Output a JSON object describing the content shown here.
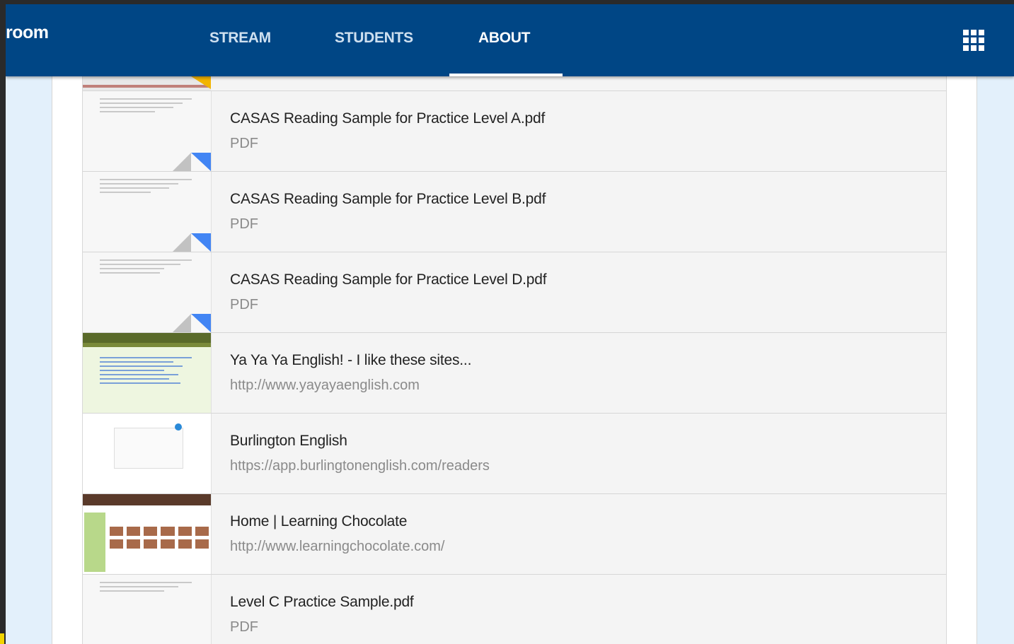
{
  "header": {
    "brand": "room",
    "tabs": [
      {
        "label": "STREAM",
        "active": false
      },
      {
        "label": "STUDENTS",
        "active": false
      },
      {
        "label": "ABOUT",
        "active": true
      }
    ],
    "apps_icon": "grid-apps-icon",
    "colors": {
      "bar": "#004685",
      "accent": "#4285f4"
    }
  },
  "materials": [
    {
      "title": "CASAS Reading Sample for Practice Level A.pdf",
      "subtitle": "PDF",
      "thumb": "pdf"
    },
    {
      "title": "CASAS Reading Sample for Practice Level B.pdf",
      "subtitle": "PDF",
      "thumb": "pdf"
    },
    {
      "title": "CASAS Reading Sample for Practice Level D.pdf",
      "subtitle": "PDF",
      "thumb": "pdf"
    },
    {
      "title": "Ya Ya Ya English! - I like these sites...",
      "subtitle": "http://www.yayayaenglish.com",
      "thumb": "web-green"
    },
    {
      "title": "Burlington English",
      "subtitle": "https://app.burlingtonenglish.com/readers",
      "thumb": "web-white"
    },
    {
      "title": "Home | Learning Chocolate",
      "subtitle": "http://www.learningchocolate.com/",
      "thumb": "web-chocolate"
    },
    {
      "title": "Level C Practice Sample.pdf",
      "subtitle": "PDF",
      "thumb": "pdf"
    }
  ]
}
